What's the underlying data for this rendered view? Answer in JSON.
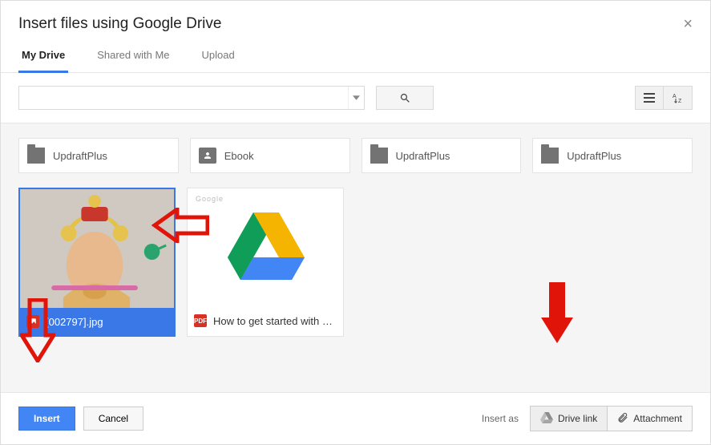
{
  "header": {
    "title": "Insert files using Google Drive"
  },
  "tabs": {
    "items": [
      "My Drive",
      "Shared with Me",
      "Upload"
    ],
    "active": 0
  },
  "search": {
    "value": "",
    "placeholder": ""
  },
  "folders": [
    {
      "label": "UpdraftPlus",
      "icon": "folder"
    },
    {
      "label": "Ebook",
      "icon": "user"
    },
    {
      "label": "UpdraftPlus",
      "icon": "folder"
    },
    {
      "label": "UpdraftPlus",
      "icon": "folder"
    }
  ],
  "files": [
    {
      "label": "[002797].jpg",
      "type": "image",
      "selected": true
    },
    {
      "label": "How to get started with …",
      "type": "pdf",
      "selected": false
    }
  ],
  "footer": {
    "insert": "Insert",
    "cancel": "Cancel",
    "insert_as_label": "Insert as",
    "drive_link": "Drive link",
    "attachment": "Attachment",
    "insert_mode_active": "drive_link"
  }
}
